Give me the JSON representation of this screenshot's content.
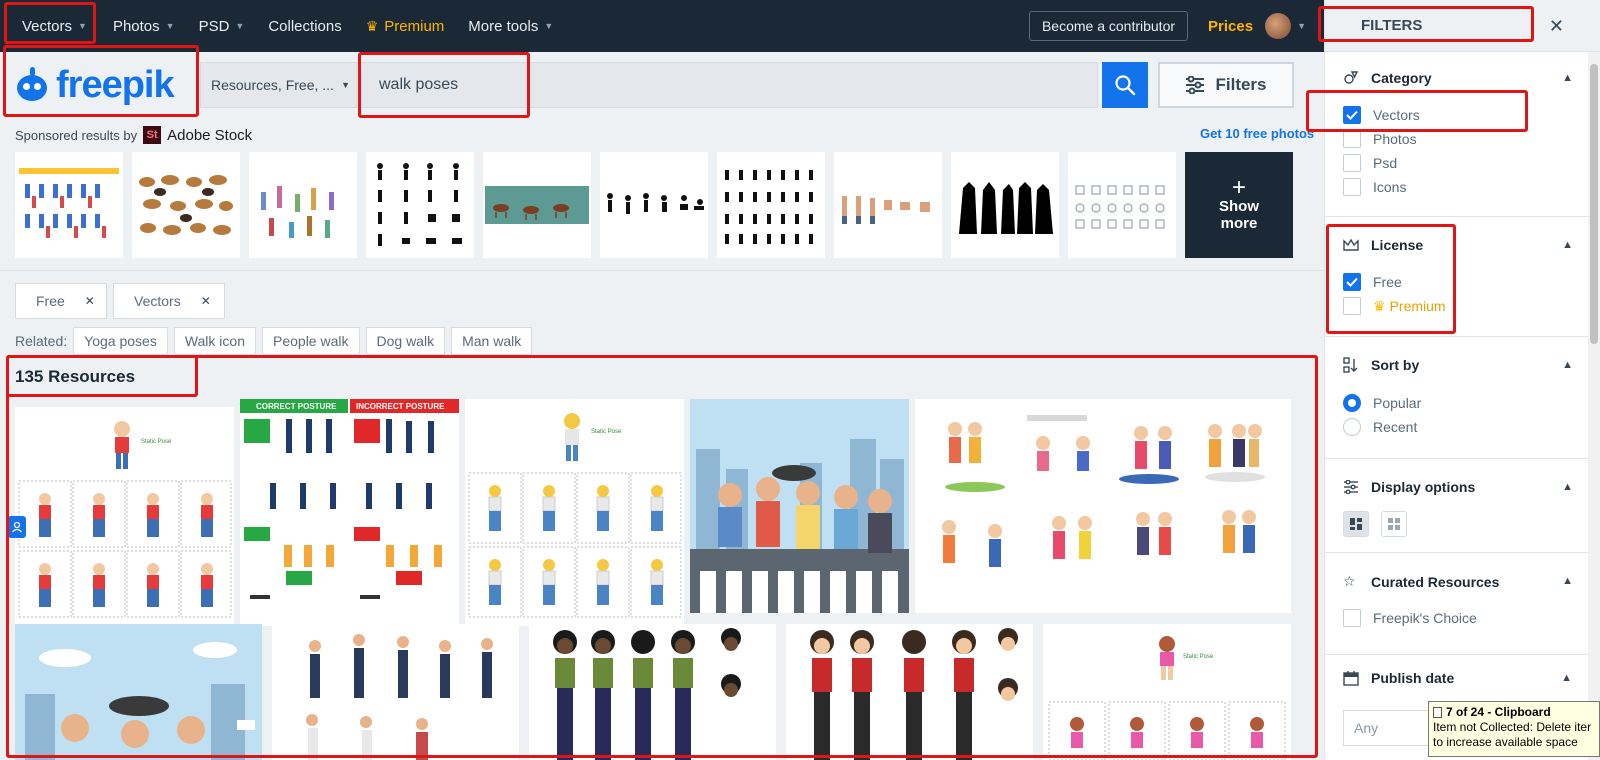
{
  "nav": {
    "items": [
      {
        "label": "Vectors",
        "dropdown": true
      },
      {
        "label": "Photos",
        "dropdown": true
      },
      {
        "label": "PSD",
        "dropdown": true
      },
      {
        "label": "Collections",
        "dropdown": false
      },
      {
        "label": "Premium",
        "dropdown": false
      },
      {
        "label": "More tools",
        "dropdown": true
      }
    ],
    "contributor_label": "Become a contributor",
    "prices_label": "Prices"
  },
  "logo": {
    "text": "freepik"
  },
  "search": {
    "resource_select": "Resources, Free, ...",
    "query": "walk poses",
    "filters_label": "Filters"
  },
  "sponsored": {
    "label": "Sponsored results by",
    "brand": "Adobe Stock",
    "brand_mark": "St",
    "get_free": "Get 10 free photos",
    "show_more_line1": "Show",
    "show_more_line2": "more"
  },
  "active_filters": [
    "Free",
    "Vectors"
  ],
  "related": {
    "label": "Related:",
    "tags": [
      "Yoga poses",
      "Walk icon",
      "People walk",
      "Dog walk",
      "Man walk"
    ]
  },
  "results": {
    "count_label": "135 Resources",
    "card_texts": {
      "static_pose": "Static Pose",
      "correct": "CORRECT POSTURE",
      "incorrect": "INCORRECT POSTURE"
    }
  },
  "filters_panel": {
    "title": "FILTERS",
    "category": {
      "title": "Category",
      "options": [
        {
          "label": "Vectors",
          "checked": true
        },
        {
          "label": "Photos",
          "checked": false
        },
        {
          "label": "Psd",
          "checked": false
        },
        {
          "label": "Icons",
          "checked": false
        }
      ]
    },
    "license": {
      "title": "License",
      "options": [
        {
          "label": "Free",
          "checked": true
        },
        {
          "label": "Premium",
          "checked": false
        }
      ]
    },
    "sort": {
      "title": "Sort by",
      "options": [
        {
          "label": "Popular",
          "selected": true
        },
        {
          "label": "Recent",
          "selected": false
        }
      ]
    },
    "display": {
      "title": "Display options"
    },
    "curated": {
      "title": "Curated Resources",
      "option": "Freepik's Choice"
    },
    "publish": {
      "title": "Publish date",
      "value": "Any"
    }
  },
  "tooltip": {
    "title": "7 of 24 - Clipboard",
    "line1": "Item not Collected: Delete iter",
    "line2": "to increase available space"
  },
  "colors": {
    "brand_blue": "#1273eb",
    "nav_dark": "#1b2835",
    "premium_gold": "#ffb400",
    "annotation_red": "#e01515"
  }
}
